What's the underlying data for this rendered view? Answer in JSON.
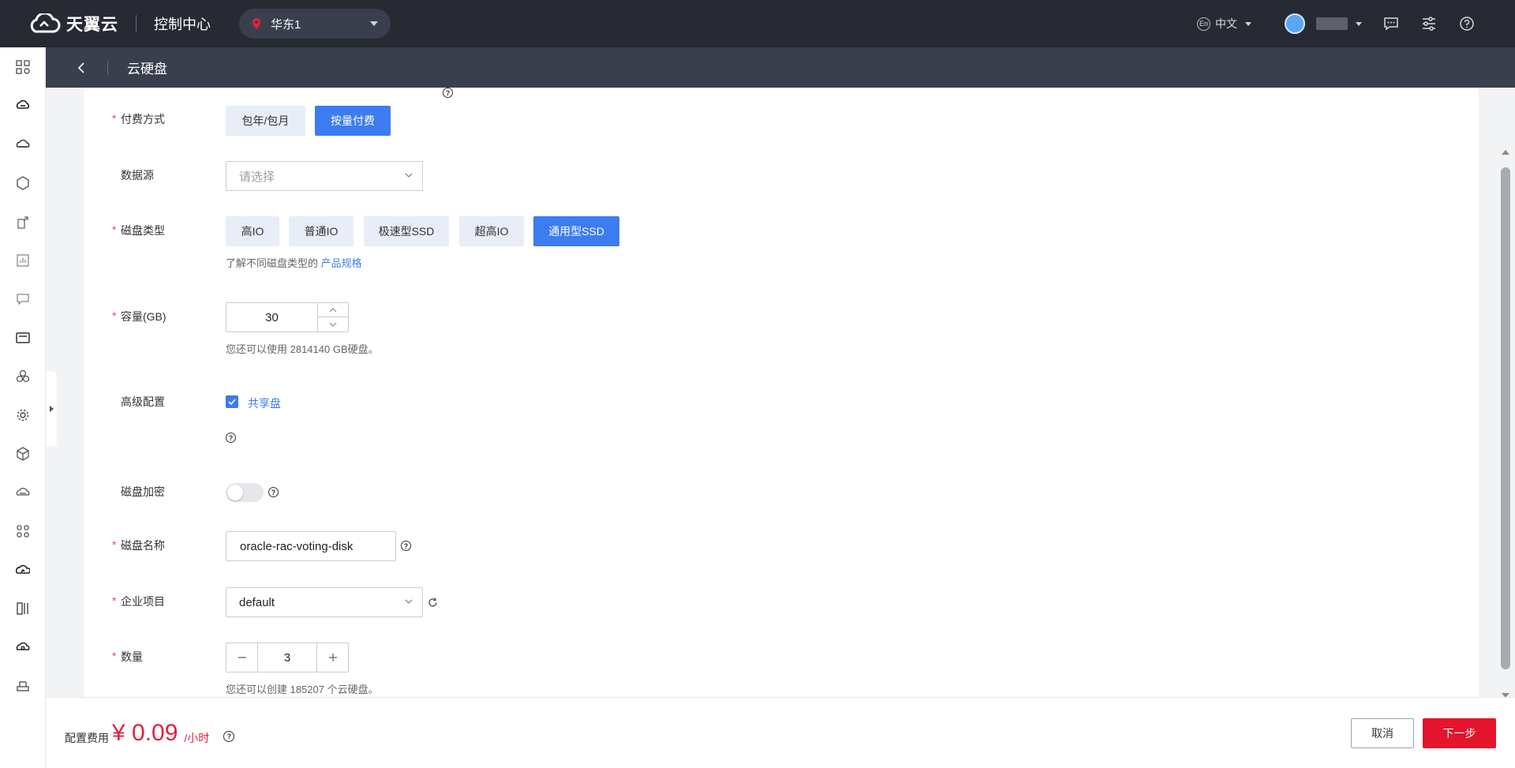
{
  "header": {
    "logo_text": "天翼云",
    "console_title": "控制中心",
    "region": "华东1",
    "lang_badge": "En",
    "language": "中文"
  },
  "subheader": {
    "title": "云硬盘"
  },
  "sidebar": {
    "icons": [
      "dashboard-icon",
      "cloud-server-icon",
      "cloud-disk-icon",
      "cube-icon",
      "elastic-ip-icon",
      "monitor-icon",
      "message-icon",
      "cloud-host-icon",
      "cluster-icon",
      "settings-gear-icon",
      "box-icon",
      "cloud-storage-icon",
      "network-icon",
      "cloud-sync-icon",
      "rack-icon",
      "cloud-backup-icon",
      "database-icon"
    ]
  },
  "form": {
    "billing": {
      "label": "付费方式",
      "options": [
        "包年/包月",
        "按量付费"
      ],
      "selected": "按量付费"
    },
    "datasource": {
      "label": "数据源",
      "placeholder": "请选择"
    },
    "disk_type": {
      "label": "磁盘类型",
      "options": [
        "高IO",
        "普通IO",
        "极速型SSD",
        "超高IO",
        "通用型SSD"
      ],
      "selected": "通用型SSD",
      "hint_prefix": "了解不同磁盘类型的",
      "hint_link": "产品规格"
    },
    "capacity": {
      "label": "容量(GB)",
      "value": "30",
      "hint": "您还可以使用 2814140 GB硬盘。"
    },
    "advanced": {
      "label": "高级配置",
      "shared_label": "共享盘",
      "shared_checked": true
    },
    "encryption": {
      "label": "磁盘加密",
      "enabled": false
    },
    "disk_name": {
      "label": "磁盘名称",
      "value": "oracle-rac-voting-disk"
    },
    "project": {
      "label": "企业项目",
      "value": "default"
    },
    "quantity": {
      "label": "数量",
      "value": "3",
      "hint": "您还可以创建 185207 个云硬盘。"
    },
    "help_mark": "?"
  },
  "footer": {
    "cost_label": "配置费用",
    "price": "¥ 0.09",
    "unit": "/小时",
    "cancel": "取消",
    "next": "下一步"
  },
  "colors": {
    "accent": "#3d7bf0",
    "danger": "#e3142c",
    "topbar": "#272a33",
    "subheader": "#3a3f4e"
  }
}
